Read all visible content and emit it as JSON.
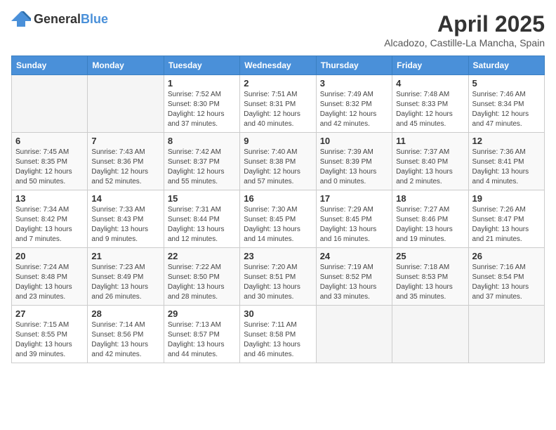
{
  "header": {
    "logo_general": "General",
    "logo_blue": "Blue",
    "month": "April 2025",
    "location": "Alcadozo, Castille-La Mancha, Spain"
  },
  "days_of_week": [
    "Sunday",
    "Monday",
    "Tuesday",
    "Wednesday",
    "Thursday",
    "Friday",
    "Saturday"
  ],
  "weeks": [
    [
      {
        "day": "",
        "info": ""
      },
      {
        "day": "",
        "info": ""
      },
      {
        "day": "1",
        "info": "Sunrise: 7:52 AM\nSunset: 8:30 PM\nDaylight: 12 hours and 37 minutes."
      },
      {
        "day": "2",
        "info": "Sunrise: 7:51 AM\nSunset: 8:31 PM\nDaylight: 12 hours and 40 minutes."
      },
      {
        "day": "3",
        "info": "Sunrise: 7:49 AM\nSunset: 8:32 PM\nDaylight: 12 hours and 42 minutes."
      },
      {
        "day": "4",
        "info": "Sunrise: 7:48 AM\nSunset: 8:33 PM\nDaylight: 12 hours and 45 minutes."
      },
      {
        "day": "5",
        "info": "Sunrise: 7:46 AM\nSunset: 8:34 PM\nDaylight: 12 hours and 47 minutes."
      }
    ],
    [
      {
        "day": "6",
        "info": "Sunrise: 7:45 AM\nSunset: 8:35 PM\nDaylight: 12 hours and 50 minutes."
      },
      {
        "day": "7",
        "info": "Sunrise: 7:43 AM\nSunset: 8:36 PM\nDaylight: 12 hours and 52 minutes."
      },
      {
        "day": "8",
        "info": "Sunrise: 7:42 AM\nSunset: 8:37 PM\nDaylight: 12 hours and 55 minutes."
      },
      {
        "day": "9",
        "info": "Sunrise: 7:40 AM\nSunset: 8:38 PM\nDaylight: 12 hours and 57 minutes."
      },
      {
        "day": "10",
        "info": "Sunrise: 7:39 AM\nSunset: 8:39 PM\nDaylight: 13 hours and 0 minutes."
      },
      {
        "day": "11",
        "info": "Sunrise: 7:37 AM\nSunset: 8:40 PM\nDaylight: 13 hours and 2 minutes."
      },
      {
        "day": "12",
        "info": "Sunrise: 7:36 AM\nSunset: 8:41 PM\nDaylight: 13 hours and 4 minutes."
      }
    ],
    [
      {
        "day": "13",
        "info": "Sunrise: 7:34 AM\nSunset: 8:42 PM\nDaylight: 13 hours and 7 minutes."
      },
      {
        "day": "14",
        "info": "Sunrise: 7:33 AM\nSunset: 8:43 PM\nDaylight: 13 hours and 9 minutes."
      },
      {
        "day": "15",
        "info": "Sunrise: 7:31 AM\nSunset: 8:44 PM\nDaylight: 13 hours and 12 minutes."
      },
      {
        "day": "16",
        "info": "Sunrise: 7:30 AM\nSunset: 8:45 PM\nDaylight: 13 hours and 14 minutes."
      },
      {
        "day": "17",
        "info": "Sunrise: 7:29 AM\nSunset: 8:45 PM\nDaylight: 13 hours and 16 minutes."
      },
      {
        "day": "18",
        "info": "Sunrise: 7:27 AM\nSunset: 8:46 PM\nDaylight: 13 hours and 19 minutes."
      },
      {
        "day": "19",
        "info": "Sunrise: 7:26 AM\nSunset: 8:47 PM\nDaylight: 13 hours and 21 minutes."
      }
    ],
    [
      {
        "day": "20",
        "info": "Sunrise: 7:24 AM\nSunset: 8:48 PM\nDaylight: 13 hours and 23 minutes."
      },
      {
        "day": "21",
        "info": "Sunrise: 7:23 AM\nSunset: 8:49 PM\nDaylight: 13 hours and 26 minutes."
      },
      {
        "day": "22",
        "info": "Sunrise: 7:22 AM\nSunset: 8:50 PM\nDaylight: 13 hours and 28 minutes."
      },
      {
        "day": "23",
        "info": "Sunrise: 7:20 AM\nSunset: 8:51 PM\nDaylight: 13 hours and 30 minutes."
      },
      {
        "day": "24",
        "info": "Sunrise: 7:19 AM\nSunset: 8:52 PM\nDaylight: 13 hours and 33 minutes."
      },
      {
        "day": "25",
        "info": "Sunrise: 7:18 AM\nSunset: 8:53 PM\nDaylight: 13 hours and 35 minutes."
      },
      {
        "day": "26",
        "info": "Sunrise: 7:16 AM\nSunset: 8:54 PM\nDaylight: 13 hours and 37 minutes."
      }
    ],
    [
      {
        "day": "27",
        "info": "Sunrise: 7:15 AM\nSunset: 8:55 PM\nDaylight: 13 hours and 39 minutes."
      },
      {
        "day": "28",
        "info": "Sunrise: 7:14 AM\nSunset: 8:56 PM\nDaylight: 13 hours and 42 minutes."
      },
      {
        "day": "29",
        "info": "Sunrise: 7:13 AM\nSunset: 8:57 PM\nDaylight: 13 hours and 44 minutes."
      },
      {
        "day": "30",
        "info": "Sunrise: 7:11 AM\nSunset: 8:58 PM\nDaylight: 13 hours and 46 minutes."
      },
      {
        "day": "",
        "info": ""
      },
      {
        "day": "",
        "info": ""
      },
      {
        "day": "",
        "info": ""
      }
    ]
  ]
}
